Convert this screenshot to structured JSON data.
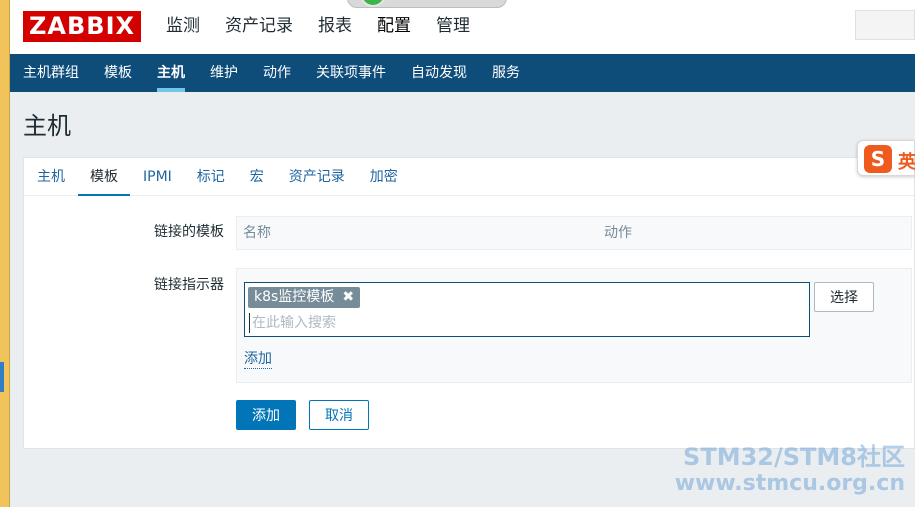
{
  "top": {
    "logo": "ZABBIX",
    "nav": [
      "监测",
      "资产记录",
      "报表",
      "配置",
      "管理"
    ],
    "active_nav": "配置"
  },
  "subnav": {
    "items": [
      "主机群组",
      "模板",
      "主机",
      "维护",
      "动作",
      "关联项事件",
      "自动发现",
      "服务"
    ],
    "active": "主机"
  },
  "page": {
    "title": "主机"
  },
  "tabs": {
    "items": [
      "主机",
      "模板",
      "IPMI",
      "标记",
      "宏",
      "资产记录",
      "加密"
    ],
    "active": "模板"
  },
  "form": {
    "linked_templates_label": "链接的模板",
    "col_name": "名称",
    "col_action": "动作",
    "link_indicator_label": "链接指示器",
    "chip_label": "k8s监控模板",
    "chip_remove": "✖",
    "search_placeholder": "在此输入搜索",
    "select_button": "选择",
    "add_link": "添加",
    "add_button": "添加",
    "cancel_button": "取消"
  },
  "ime": {
    "logo": "S",
    "lang": "英"
  },
  "watermark": {
    "line1": "STM32/STM8社区",
    "line2": "www.stmcu.org.cn"
  },
  "colors": {
    "brand_red": "#d40000",
    "subnav_bg": "#0e4d7a",
    "link": "#1f66a0",
    "primary": "#0275b8"
  }
}
